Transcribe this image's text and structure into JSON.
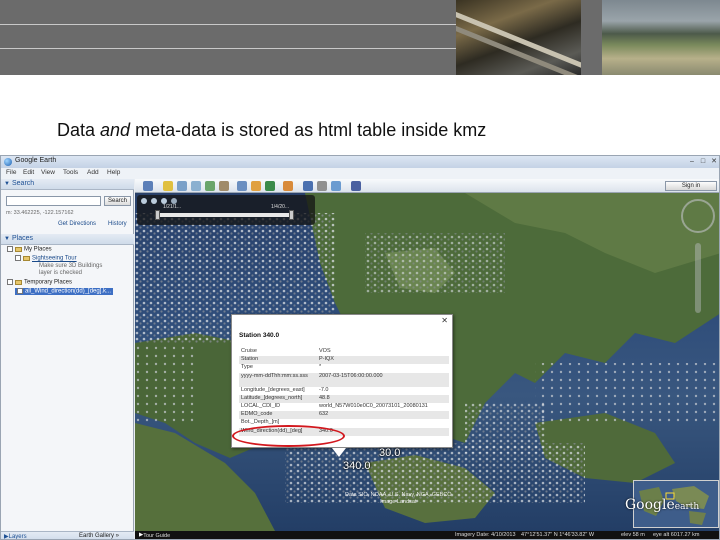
{
  "slide": {
    "title_part1": "Data ",
    "title_italic": "and",
    "title_part2": " meta-data is stored as html table inside kmz"
  },
  "window": {
    "app_title": "Google Earth",
    "controls": [
      "–",
      "□",
      "✕"
    ]
  },
  "menu": [
    "File",
    "Edit",
    "View",
    "Tools",
    "Add",
    "Help"
  ],
  "sidebar": {
    "search_header": "Search",
    "search_button": "Search",
    "search_input_value": "",
    "coordinates": "m: 33.462225, -122.157162",
    "get_directions": "Get Directions",
    "history": "History",
    "places_header": "Places",
    "places": [
      {
        "label": "My Places",
        "kind": "folder"
      },
      {
        "label": "Sightseeing Tour",
        "kind": "link"
      },
      {
        "label": "Make sure 3D Buildings",
        "kind": "note"
      },
      {
        "label": "layer is checked",
        "kind": "note"
      },
      {
        "label": "Temporary Places",
        "kind": "folder"
      },
      {
        "label": "all_Wind_direction(dd)_[deg].k...",
        "kind": "selected"
      }
    ],
    "layers_header": "Layers",
    "earth_gallery": "Earth Gallery »"
  },
  "toolbar": {
    "sign_in": "Sign in"
  },
  "timeslider": {
    "start_label": "1/21/1...",
    "end_label": "1/4/20..."
  },
  "balloon": {
    "title": "Station 340.0",
    "close": "✕",
    "rows": [
      {
        "key": "Cruise",
        "value": "VOS"
      },
      {
        "key": "Station",
        "value": "P-IQX"
      },
      {
        "key": "Type",
        "value": "*"
      },
      {
        "key": "yyyy-mm-ddThh:mm:ss.sss",
        "value": "2007-03-15T06:00:00.000"
      },
      {
        "key": "Longitude_[degrees_east]",
        "value": "-7.0"
      },
      {
        "key": "Latitude_[degrees_north]",
        "value": "48.8"
      },
      {
        "key": "LOCAL_CDI_ID",
        "value": "world_N57W010e0C0_20073101_20080131"
      },
      {
        "key": "EDMO_code",
        "value": "632"
      },
      {
        "key": "Bot._Depth_[m]",
        "value": ""
      },
      {
        "key": "Wind_direction(dd)_[deg]",
        "value": "340.0"
      }
    ]
  },
  "map": {
    "labels": [
      {
        "text": "30.0"
      },
      {
        "text": "340.0"
      }
    ],
    "copyright_line1": "Data SIO, NOAA, U.S. Navy, NGA, GEBCO",
    "copyright_line2": "Image Landsat",
    "wordmark": "Google",
    "wordmark_small": "earth"
  },
  "statusbar": {
    "tour_guide": "Tour Guide",
    "imagery_date": "Imagery Date: 4/10/2013",
    "coordinates": "47°12'51.37\" N   1°46'33.82\" W",
    "elevation": "elev  58 m",
    "eye_alt": "eye alt 6017.27 km"
  },
  "colors": {
    "header_band": "#6b6b6b",
    "ocean": "#2f4d7a",
    "land": "#4d6b3a",
    "highlight": "#d2181e",
    "selection": "#3d6fc4"
  }
}
